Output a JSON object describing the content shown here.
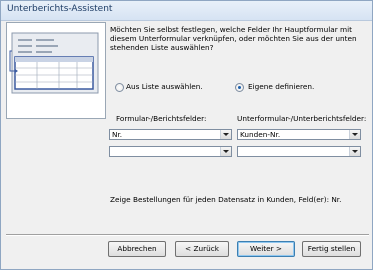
{
  "window": {
    "title": "Unterberichts-Assistent"
  },
  "question": {
    "lines": [
      "Möchten Sie selbst festlegen, welche Felder Ihr Hauptformular mit",
      "diesem Unterformular verknüpfen, oder möchten Sie aus der unten",
      "stehenden Liste auswählen?"
    ]
  },
  "options": {
    "from_list": {
      "label": "Aus Liste auswählen.",
      "selected": false
    },
    "define_own": {
      "label": "Eigene definieren.",
      "selected": true
    }
  },
  "fields": {
    "main_header": "Formular-/Berichtsfelder:",
    "sub_header": "Unterformular-/Unterberichtsfelder:",
    "main_values": [
      "Nr.",
      ""
    ],
    "sub_values": [
      "Kunden-Nr.",
      ""
    ]
  },
  "summary": "Zeige Bestellungen für jeden Datensatz in Kunden, Feld(er): Nr.",
  "buttons": {
    "cancel": "Abbrechen",
    "back": "< Zurück",
    "next": "Weiter >",
    "finish": "Fertig stellen"
  },
  "colors": {
    "accent": "#1d5fab",
    "illustration_blue": "#3a5aa0",
    "border": "#8fa6c2"
  }
}
